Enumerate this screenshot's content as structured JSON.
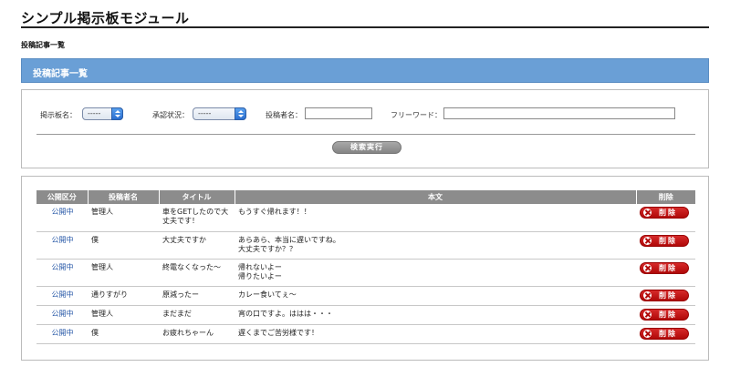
{
  "header": {
    "title": "シンプル掲示板モジュール",
    "breadcrumb": "投稿記事一覧"
  },
  "section": {
    "title": "投稿記事一覧"
  },
  "search": {
    "board_label": "掲示板名：",
    "board_value": "-----",
    "approval_label": "承認状況：",
    "approval_value": "-----",
    "poster_label": "投稿者名：",
    "poster_value": "",
    "freeword_label": "フリーワード：",
    "freeword_value": "",
    "button_label": "検索実行"
  },
  "table": {
    "columns": [
      "公開区分",
      "投稿者名",
      "タイトル",
      "本文",
      "削除"
    ],
    "delete_label": "削除",
    "rows": [
      {
        "status": "公開中",
        "author": "管理人",
        "title": "車をGETしたので大丈夫です！",
        "body": "もうすぐ帰れます！！"
      },
      {
        "status": "公開中",
        "author": "僕",
        "title": "大丈夫ですか",
        "body": "あらあら、本当に遅いですね。\n大丈夫ですか？？"
      },
      {
        "status": "公開中",
        "author": "管理人",
        "title": "終電なくなった〜",
        "body": "帰れないよー\n帰りたいよー"
      },
      {
        "status": "公開中",
        "author": "通りすがり",
        "title": "原減ったー",
        "body": "カレー食いてぇ〜"
      },
      {
        "status": "公開中",
        "author": "管理人",
        "title": "まだまだ",
        "body": "宵の口ですよ。ははは・・・"
      },
      {
        "status": "公開中",
        "author": "僕",
        "title": "お疲れちゃーん",
        "body": "遅くまでご苦労様です！"
      }
    ]
  },
  "colors": {
    "section_bar": "#6a9fd6",
    "table_header": "#8c8c8c",
    "delete_button": "#c01010",
    "status_link": "#2a5aa8"
  }
}
